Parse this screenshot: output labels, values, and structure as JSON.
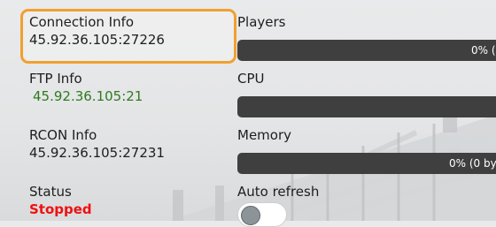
{
  "connection": {
    "label": "Connection Info",
    "value": "45.92.36.105:27226"
  },
  "ftp": {
    "label": "FTP Info",
    "value": "45.92.36.105:21"
  },
  "rcon": {
    "label": "RCON Info",
    "value": "45.92.36.105:27231"
  },
  "status": {
    "label": "Status",
    "value": "Stopped",
    "color": "#ee1111"
  },
  "players": {
    "label": "Players",
    "bar_text": "0% (",
    "fill_fraction": 0
  },
  "cpu": {
    "label": "CPU",
    "bar_text": "",
    "fill_fraction": 0
  },
  "memory": {
    "label": "Memory",
    "bar_text": "0% (0 by",
    "fill_fraction": 0
  },
  "auto_refresh": {
    "label": "Auto refresh",
    "enabled": false
  },
  "colors": {
    "highlight": "#f0a030",
    "bar": "#3f3f3f",
    "green_text": "#2f7a1f"
  }
}
